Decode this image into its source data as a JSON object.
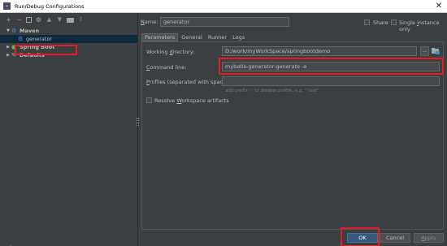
{
  "window": {
    "title": "Run/Debug Configurations",
    "close_glyph": "✕"
  },
  "toolbar": {
    "add": "+",
    "remove": "−",
    "gear": "⚙",
    "up": "▲",
    "down": "▼",
    "sort": "↕"
  },
  "tree": {
    "maven": {
      "label": "Maven",
      "expanded": true,
      "icon": "maven-icon",
      "children": [
        {
          "label": "generator",
          "selected": true,
          "icon": "gear-icon"
        }
      ]
    },
    "spring": {
      "label": "Spring Boot",
      "expanded": false,
      "icon": "spring-boot-icon"
    },
    "defaults": {
      "label": "Defaults",
      "expanded": false,
      "icon": "wrench-icon"
    }
  },
  "config": {
    "name_label_prefix": "N",
    "name_label_rest": "ame:",
    "name_value": "generator",
    "share_label": "Share",
    "single_label_prefix": "Single ",
    "single_label_key": "i",
    "single_label_rest": "nstance only",
    "tabs": [
      "Parameters",
      "General",
      "Runner",
      "Logs"
    ],
    "active_tab": "Parameters",
    "wd_label_prefix": "Working ",
    "wd_label_key": "d",
    "wd_label_rest": "irectory:",
    "wd_value": "D:/work/myWorkSpace/springbootdemo",
    "ellipsis": "...",
    "cmd_label_prefix": "",
    "cmd_label_key": "C",
    "cmd_label_rest": "ommand line:",
    "cmd_value": "mybatis-generator:generate -e",
    "profiles_label_prefix": "",
    "profiles_label_key": "P",
    "profiles_label_rest": "rofiles (separated with space):",
    "profiles_value": "",
    "profiles_hint": "add prefix '-' to disable profile, e.g. \"-test\"",
    "resolve_label_prefix": "Resolve ",
    "resolve_label_key": "W",
    "resolve_label_rest": "orkspace artifacts",
    "resolve_checked": false
  },
  "buttons": {
    "ok": "OK",
    "cancel": "Cancel",
    "apply_prefix": "",
    "apply_key": "A",
    "apply_rest": "pply",
    "help": "?"
  },
  "colors": {
    "highlight": "#e51c23",
    "ok_button": "#365880",
    "background": "#3c3f41",
    "selection": "#0d293e"
  }
}
